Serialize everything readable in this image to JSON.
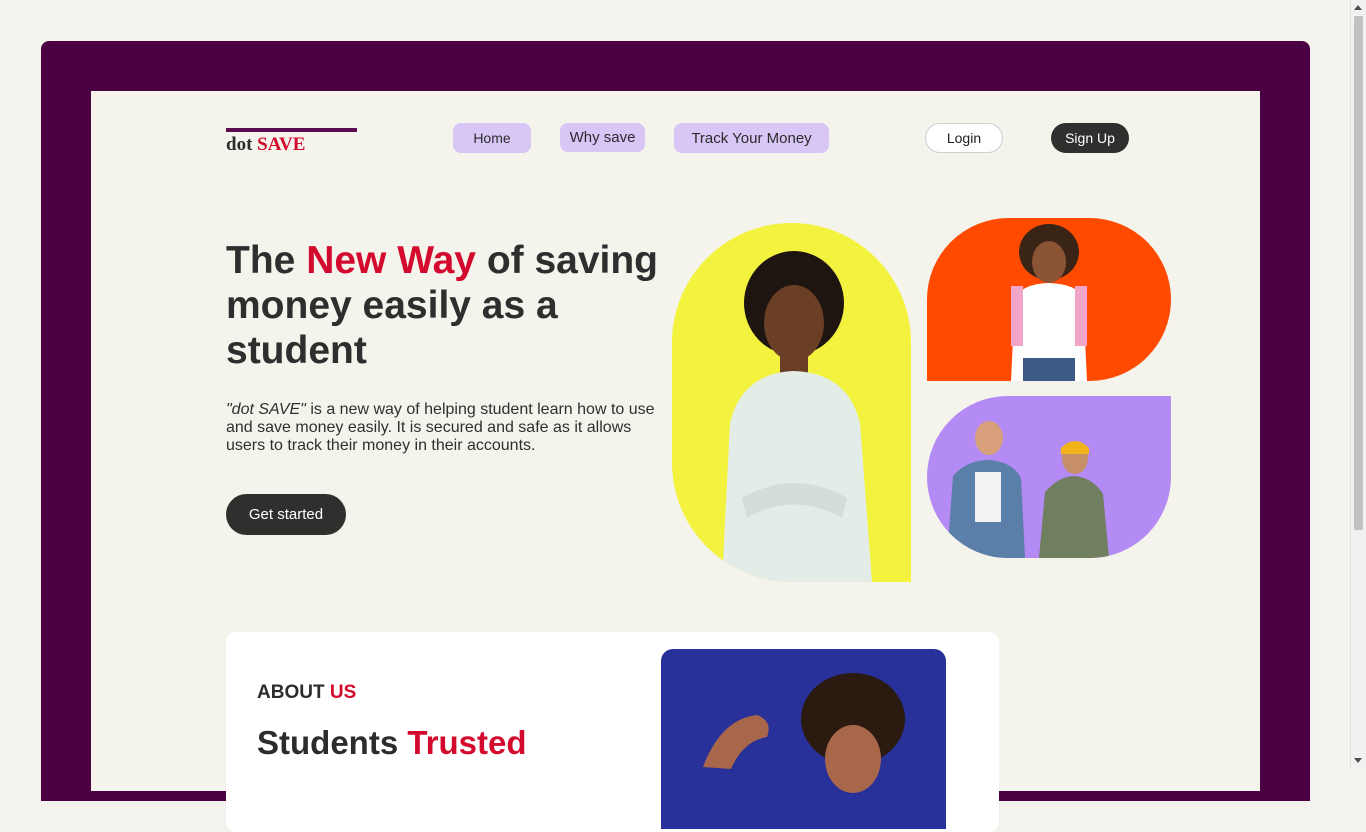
{
  "brand": {
    "name_part1": "dot",
    "name_part2": "SAVE"
  },
  "nav": {
    "home": "Home",
    "why_save": "Why save",
    "track": "Track Your Money",
    "login": "Login",
    "signup": "Sign Up"
  },
  "hero": {
    "title_start": "The",
    "title_accent": "New Way",
    "title_end": "of saving money easily as a student",
    "desc_italic": "\"dot SAVE\"",
    "desc_rest": "is a new way of helping student learn how to use and save money easily. It is secured and safe as it allows users to track their money in their accounts.",
    "cta": "Get started"
  },
  "about": {
    "label_start": "ABOUT",
    "label_accent": "US",
    "heading_start": "Students",
    "heading_accent": "Trusted"
  },
  "colors": {
    "frame": "#4b0043",
    "accent": "#d30a2e",
    "nav_pill": "#d8c6f7",
    "yellow": "#f3f33f",
    "orange": "#ff4a00",
    "purple": "#b48af5",
    "blue": "#28319a"
  }
}
